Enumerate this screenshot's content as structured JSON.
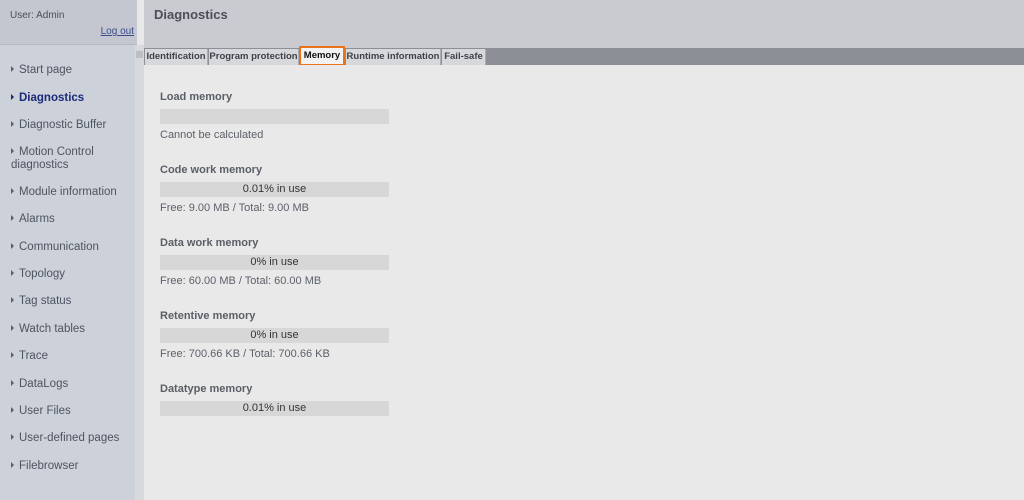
{
  "user": {
    "label": "User: Admin",
    "logout": "Log out"
  },
  "header": {
    "title": "Diagnostics"
  },
  "sidebar": {
    "items": [
      {
        "label": "Start page"
      },
      {
        "label": "Diagnostics",
        "active": true
      },
      {
        "label": "Diagnostic Buffer"
      },
      {
        "label": "Motion Control diagnostics"
      },
      {
        "label": "Module information"
      },
      {
        "label": "Alarms"
      },
      {
        "label": "Communication"
      },
      {
        "label": "Topology"
      },
      {
        "label": "Tag status"
      },
      {
        "label": "Watch tables"
      },
      {
        "label": "Trace"
      },
      {
        "label": "DataLogs"
      },
      {
        "label": "User Files"
      },
      {
        "label": "User-defined pages"
      },
      {
        "label": "Filebrowser"
      }
    ]
  },
  "tabs": [
    {
      "label": "Identification"
    },
    {
      "label": "Program protection"
    },
    {
      "label": "Memory",
      "active": true
    },
    {
      "label": "Runtime information"
    },
    {
      "label": "Fail-safe"
    }
  ],
  "memory": {
    "load": {
      "title": "Load memory",
      "usage": "",
      "note": "Cannot be calculated"
    },
    "code": {
      "title": "Code work memory",
      "usage": "0.01% in use",
      "note": "Free: 9.00 MB / Total: 9.00 MB"
    },
    "data": {
      "title": "Data work memory",
      "usage": "0% in use",
      "note": "Free: 60.00 MB / Total: 60.00 MB"
    },
    "retentive": {
      "title": "Retentive memory",
      "usage": "0% in use",
      "note": "Free: 700.66 KB / Total: 700.66 KB"
    },
    "datatype": {
      "title": "Datatype memory",
      "usage": "0.01% in use"
    }
  },
  "colors": {
    "active_tab_border": "#e8731a",
    "active_nav": "#1a2a7a"
  }
}
